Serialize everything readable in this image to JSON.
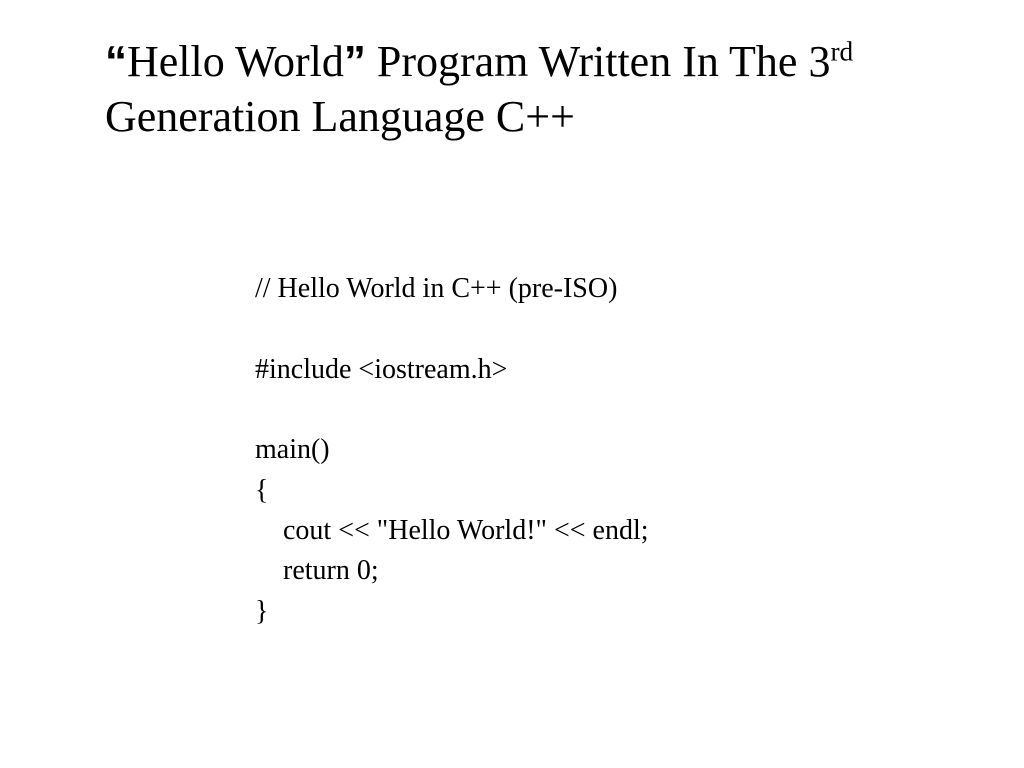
{
  "title": {
    "open_quote": "“",
    "part1": "Hello World",
    "close_quote": "”",
    "part2": " Program Written In The  3",
    "sup": "rd",
    "part3": " Generation Language C++"
  },
  "code": {
    "line1": "// Hello World in C++ (pre-ISO)",
    "line2": "",
    "line3": "#include <iostream.h>",
    "line4": "",
    "line5": "main()",
    "line6": "{",
    "line7": "    cout << \"Hello World!\" << endl;",
    "line8": "    return 0;",
    "line9": "}"
  }
}
